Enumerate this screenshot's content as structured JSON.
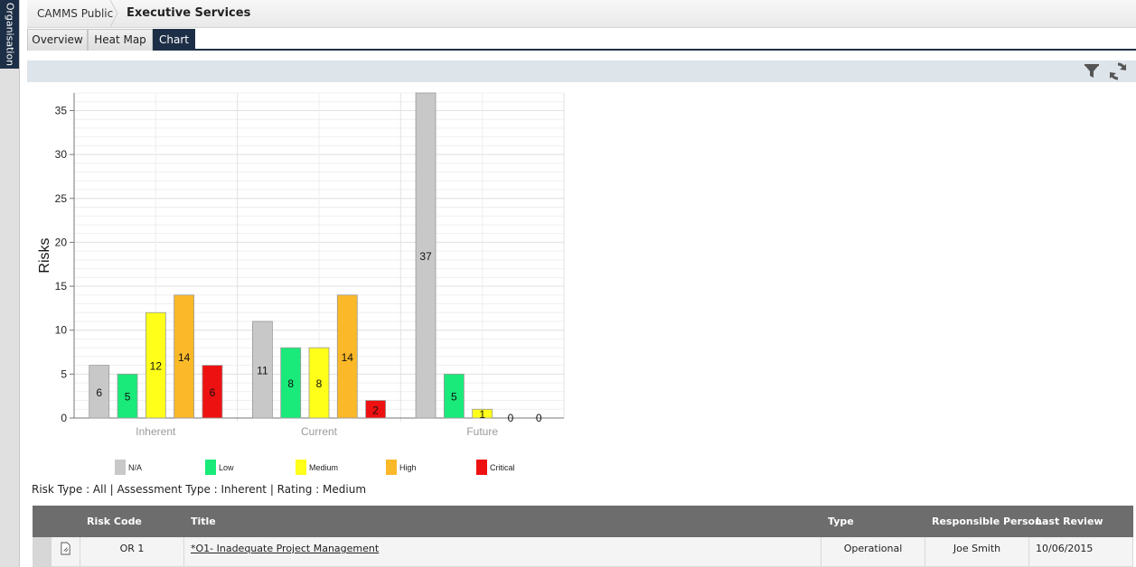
{
  "sidebar": {
    "tab_label": "Organisation"
  },
  "breadcrumb": {
    "root": "CAMMS Public",
    "current": "Executive Services"
  },
  "tabs": [
    {
      "label": "Overview"
    },
    {
      "label": "Heat Map"
    },
    {
      "label": "Chart",
      "active": true
    }
  ],
  "toolbar": {
    "filter_icon": "filter-icon",
    "refresh_icon": "refresh-icon"
  },
  "chart_data": {
    "type": "bar",
    "title": "",
    "xlabel": "",
    "ylabel": "Risks",
    "ylim": [
      0,
      37
    ],
    "yticks": [
      0,
      5,
      10,
      15,
      20,
      25,
      30,
      35
    ],
    "grid": true,
    "legend_position": "bottom",
    "categories": [
      "Inherent",
      "Current",
      "Future"
    ],
    "series": [
      {
        "name": "N/A",
        "color": "#c8c8c8",
        "values": [
          6,
          11,
          37
        ]
      },
      {
        "name": "Low",
        "color": "#19ea7a",
        "values": [
          5,
          8,
          5
        ]
      },
      {
        "name": "Medium",
        "color": "#ffff1a",
        "values": [
          12,
          8,
          1
        ]
      },
      {
        "name": "High",
        "color": "#fbb828",
        "values": [
          14,
          14,
          0
        ]
      },
      {
        "name": "Critical",
        "color": "#ee1111",
        "values": [
          6,
          2,
          0
        ]
      }
    ]
  },
  "filter_summary": "Risk Type : All | Assessment Type : Inherent | Rating : Medium",
  "table": {
    "columns": [
      "Risk Code",
      "Title",
      "Type",
      "Responsible Person",
      "Last Review"
    ],
    "rows": [
      {
        "risk_code": "OR 1",
        "title": "*O1- Inadequate Project Management",
        "type": "Operational",
        "responsible": "Joe Smith",
        "last_review": "10/06/2015"
      }
    ]
  }
}
